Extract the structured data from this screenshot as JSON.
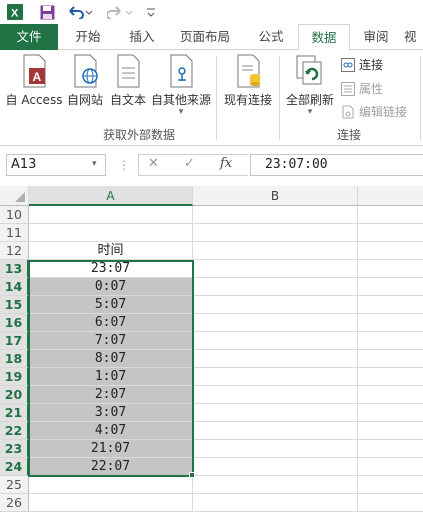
{
  "qat": {
    "excel_icon": "excel-logo-icon",
    "save_icon": "save-icon",
    "undo_icon": "undo-icon",
    "redo_icon": "redo-icon",
    "customize_icon": "customize-qat-icon"
  },
  "tabs": [
    {
      "label": "文件",
      "kind": "file"
    },
    {
      "label": "开始",
      "kind": "normal"
    },
    {
      "label": "插入",
      "kind": "normal"
    },
    {
      "label": "页面布局",
      "kind": "normal"
    },
    {
      "label": "公式",
      "kind": "normal"
    },
    {
      "label": "数据",
      "kind": "active"
    },
    {
      "label": "审阅",
      "kind": "normal"
    },
    {
      "label": "视",
      "kind": "normal"
    }
  ],
  "ribbon": {
    "external_group_label": "获取外部数据",
    "connections_group_label": "连接",
    "buttons": {
      "from_access": "自 Access",
      "from_web": "自网站",
      "from_text": "自文本",
      "from_other": "自其他来源",
      "existing_connections": "现有连接",
      "refresh_all": "全部刷新",
      "connections": "连接",
      "properties": "属性",
      "edit_links": "编辑链接"
    }
  },
  "formula_bar": {
    "name_box": "A13",
    "formula": "23:07:00",
    "cancel_symbol": "✕",
    "enter_symbol": "✓",
    "fx_symbol": "fx"
  },
  "columns": [
    "A",
    "B"
  ],
  "rows": [
    {
      "num": "10",
      "a": ""
    },
    {
      "num": "11",
      "a": ""
    },
    {
      "num": "12",
      "a": "时间"
    },
    {
      "num": "13",
      "a": "23:07"
    },
    {
      "num": "14",
      "a": "0:07"
    },
    {
      "num": "15",
      "a": "5:07"
    },
    {
      "num": "16",
      "a": "6:07"
    },
    {
      "num": "17",
      "a": "7:07"
    },
    {
      "num": "18",
      "a": "8:07"
    },
    {
      "num": "19",
      "a": "1:07"
    },
    {
      "num": "20",
      "a": "2:07"
    },
    {
      "num": "21",
      "a": "3:07"
    },
    {
      "num": "22",
      "a": "4:07"
    },
    {
      "num": "23",
      "a": "21:07"
    },
    {
      "num": "24",
      "a": "22:07"
    },
    {
      "num": "25",
      "a": ""
    },
    {
      "num": "26",
      "a": ""
    }
  ],
  "colors": {
    "accent": "#217346",
    "selection_fill": "#c5c5c5"
  }
}
